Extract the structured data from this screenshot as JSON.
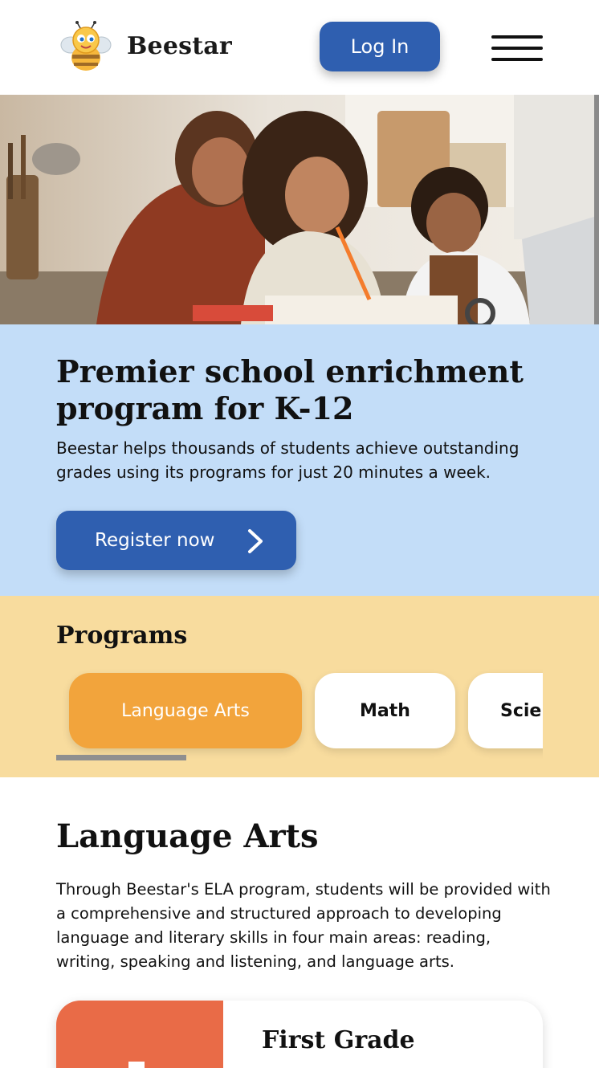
{
  "header": {
    "brand": "Beestar",
    "login_label": "Log In"
  },
  "hero": {
    "headline": "Premier school enrichment program for K-12",
    "subtext": "Beestar helps thousands of students achieve outstanding grades using its programs for just 20 minutes a week.",
    "register_label": "Register now"
  },
  "programs": {
    "title": "Programs",
    "tabs": [
      {
        "label": "Language Arts",
        "active": true
      },
      {
        "label": "Math",
        "active": false
      },
      {
        "label": "Science",
        "active": false
      }
    ],
    "scroll_progress": 0.27
  },
  "language_arts": {
    "title": "Language Arts",
    "description": "Through Beestar's ELA program, students will be provided with a comprehensive and structured approach to developing language and literary skills in four main areas: reading, writing, speaking and listening, and language arts."
  },
  "grade_card": {
    "title": "First Grade",
    "accent_color": "#e96b47"
  },
  "colors": {
    "primary_blue": "#2f5fb0",
    "banner_blue": "#c3ddf8",
    "programs_yellow": "#f8dc9e",
    "active_tab_orange": "#f2a43c"
  },
  "icons": {
    "logo": "bee-mascot-icon",
    "menu": "hamburger-menu-icon",
    "register_arrow": "chevron-right-icon"
  }
}
